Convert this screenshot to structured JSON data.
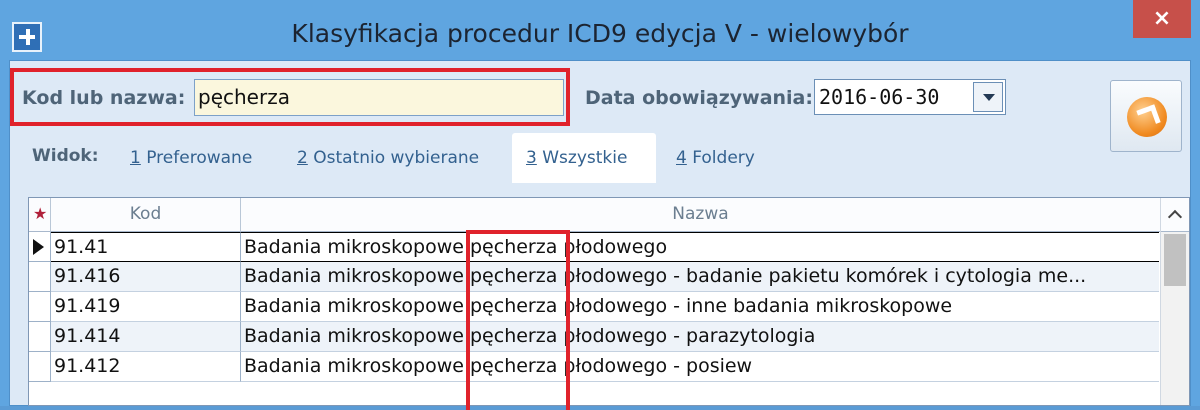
{
  "window": {
    "title": "Klasyfikacja procedur ICD9 edycja V - wielowybór",
    "close_label": "×"
  },
  "search": {
    "label": "Kod lub nazwa:",
    "value": "pęcherza"
  },
  "date": {
    "label": "Data obowiązywania:",
    "value": "2016-06-30"
  },
  "view": {
    "label": "Widok:",
    "tabs": [
      {
        "key": "1",
        "label": " Preferowane"
      },
      {
        "key": "2",
        "label": " Ostatnio wybierane"
      },
      {
        "key": "3",
        "label": " Wszystkie"
      },
      {
        "key": "4",
        "label": " Foldery"
      }
    ],
    "active_tab": "Wszystkie"
  },
  "grid": {
    "columns": {
      "star": "★",
      "kod": "Kod",
      "nazwa": "Nazwa"
    },
    "rows": [
      {
        "kod": "91.41",
        "nazwa": "Badania mikroskopowe pęcherza płodowego"
      },
      {
        "kod": "91.416",
        "nazwa": "Badania mikroskopowe pęcherza płodowego - badanie pakietu komórek i cytologia me..."
      },
      {
        "kod": "91.419",
        "nazwa": "Badania mikroskopowe pęcherza płodowego - inne badania mikroskopowe"
      },
      {
        "kod": "91.414",
        "nazwa": "Badania mikroskopowe pęcherza płodowego - parazytologia"
      },
      {
        "kod": "91.412",
        "nazwa": "Badania mikroskopowe pęcherza płodowego - posiew"
      }
    ],
    "selected_row": 0
  },
  "colors": {
    "title_bar": "#5fa5e0",
    "highlight": "#e0222b",
    "input_bg": "#fbf7dd",
    "close_button": "#c7504a"
  },
  "icons": {
    "app": "plus-icon",
    "close": "close-icon",
    "action": "orange-arrow-icon",
    "dropdown": "chevron-down-icon",
    "row_pointer": "row-pointer-icon",
    "scroll_up": "chevron-up-icon"
  }
}
